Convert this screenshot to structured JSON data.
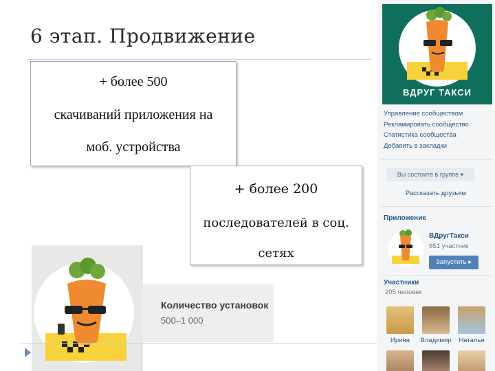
{
  "slide": {
    "title": "6 этап. Продвижение",
    "box1": {
      "line1": "+ более 500",
      "line2": "скачиваний приложения на",
      "line3": "моб. устройства"
    },
    "box2": {
      "line1": "+ более 200",
      "line2": "последователей в соц.",
      "line3": "сетях"
    }
  },
  "install_card": {
    "title": "Количество установок",
    "value": "500–1 000"
  },
  "vk": {
    "logo_text": "ВДРУГ ТАКСИ",
    "menu": [
      "Управление сообществом",
      "Рекламировать сообщество",
      "Статистика сообщества",
      "Добавить в закладки"
    ],
    "member_button": "Вы состоите в группе ▾",
    "share_link": "Рассказать друзьям",
    "app_section": "Приложение",
    "app_name": "ВДругТакси",
    "app_members": "651 участник",
    "launch_button": "Запустить ▸",
    "members_section": "Участники",
    "members_count": "205 человек",
    "members": [
      "Ирина",
      "Владимир",
      "Наталья"
    ]
  },
  "colors": {
    "vk_green": "#0f6f5c",
    "vk_blue": "#2a5885",
    "vk_button": "#5181b8",
    "carrot": "#f08a30",
    "leaf": "#6fa83a",
    "taxi_yellow": "#f7d23a"
  }
}
